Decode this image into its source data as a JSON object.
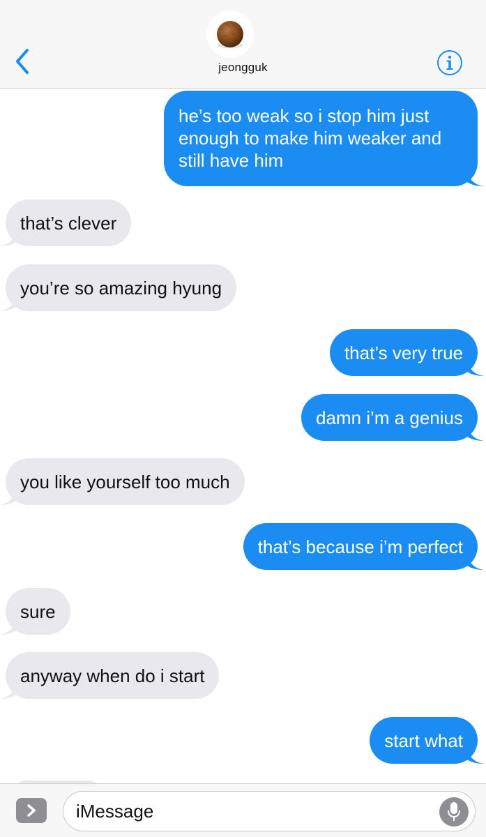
{
  "header": {
    "contact_name": "jeongguk",
    "avatar_icon": "coconut-avatar-icon",
    "back_icon": "chevron-left-icon",
    "info_icon": "info-circle-icon",
    "accent_color": "#1a8cf2"
  },
  "messages": [
    {
      "direction": "outgoing",
      "lines": [
        "he’s too weak so i stop him just",
        "enough to make him weaker and",
        "still have him"
      ]
    },
    {
      "direction": "incoming",
      "lines": [
        "that’s clever"
      ]
    },
    {
      "direction": "incoming",
      "lines": [
        "you’re so amazing hyung"
      ]
    },
    {
      "direction": "outgoing",
      "lines": [
        "that’s very true"
      ]
    },
    {
      "direction": "outgoing",
      "lines": [
        "damn i’m a genius"
      ]
    },
    {
      "direction": "incoming",
      "lines": [
        "you like yourself too much"
      ]
    },
    {
      "direction": "outgoing",
      "lines": [
        "that’s because i’m perfect"
      ]
    },
    {
      "direction": "incoming",
      "lines": [
        "sure"
      ]
    },
    {
      "direction": "incoming",
      "lines": [
        "anyway when do i start"
      ]
    },
    {
      "direction": "outgoing",
      "lines": [
        "start what"
      ]
    }
  ],
  "colors": {
    "outgoing_bubble": "#1a8cf2",
    "incoming_bubble": "#e8e8ed"
  },
  "input_bar": {
    "placeholder": "iMessage",
    "apps_icon": "chevron-right-icon",
    "mic_icon": "microphone-icon"
  }
}
